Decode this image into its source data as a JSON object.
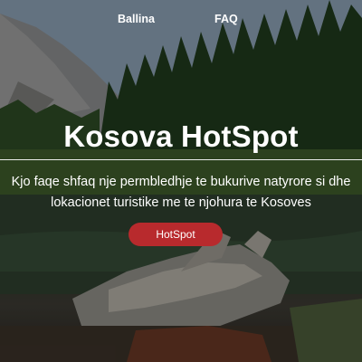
{
  "nav": {
    "home_label": "Ballina",
    "faq_label": "FAQ"
  },
  "hero": {
    "title": "Kosova HotSpot",
    "description": "Kjo faqe shfaq nje permbledhje te bukurive natyrore si dhe lokacionet turistike me te njohura te Kosoves",
    "cta_label": "HotSpot"
  },
  "colors": {
    "cta_background": "#b82a2d",
    "text": "#ffffff"
  }
}
